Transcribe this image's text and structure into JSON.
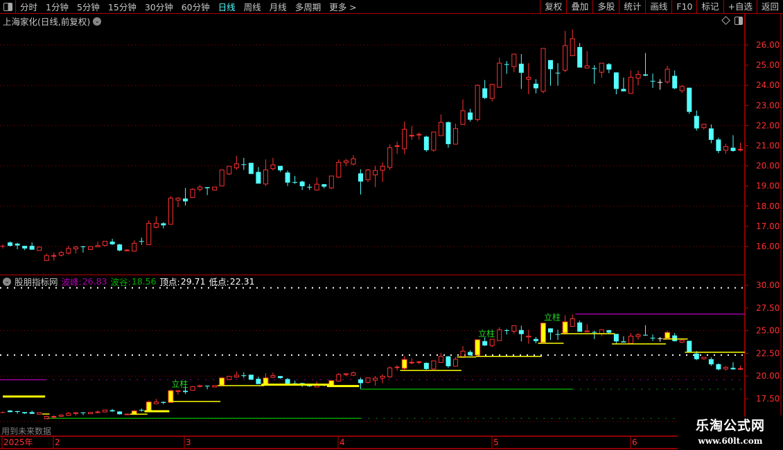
{
  "toolbar": {
    "periods": [
      "分时",
      "1分钟",
      "5分钟",
      "15分钟",
      "30分钟",
      "60分钟",
      "日线",
      "周线",
      "月线",
      "多周期",
      "更多 >"
    ],
    "active_period": "日线",
    "buttons": [
      "复权",
      "叠加",
      "多股",
      "统计",
      "画线",
      "F10",
      "标记",
      "+自选",
      "返回"
    ]
  },
  "chart_title": "上海家化(日线,前复权)",
  "indicator": {
    "name": "股朋指标网",
    "peak_label": "波峰:",
    "peak_value": "26.83",
    "trough_label": "波谷:",
    "trough_value": "18.56",
    "top_label": "顶点:",
    "top_value": "29.71",
    "low_label": "低点:",
    "low_value": "22.31",
    "signal_label": "立柱",
    "future_note": "用到未来数据"
  },
  "colors": {
    "up": "#ff3232",
    "down": "#54ffff",
    "highlight": "#ffff00",
    "axis": "#c00000",
    "peak": "#a000a0",
    "trough": "#00a000",
    "active_tab": "#54ffff"
  },
  "price_axis": {
    "labels": [
      "26.00",
      "25.00",
      "24.00",
      "23.00",
      "22.00",
      "21.00",
      "20.00",
      "19.00",
      "18.00",
      "17.00",
      "16.00"
    ]
  },
  "indicator_axis": {
    "labels": [
      "30.00",
      "27.50",
      "25.00",
      "22.50",
      "20.00",
      "17.50"
    ]
  },
  "date_axis": {
    "labels": [
      "2025年",
      "2",
      "3",
      "4",
      "5",
      "6"
    ]
  },
  "watermark": {
    "line1": "乐淘公式网",
    "line2": "www.60lt.com"
  },
  "chart_data": {
    "type": "candlestick",
    "ohlc_fields": [
      "open",
      "high",
      "low",
      "close"
    ],
    "candles": [
      [
        16.03,
        16.1,
        15.9,
        16.03
      ],
      [
        16.2,
        16.25,
        16.0,
        16.03
      ],
      [
        16.14,
        16.18,
        15.86,
        16.05
      ],
      [
        16.03,
        16.03,
        15.82,
        15.9
      ],
      [
        16.03,
        16.2,
        15.84,
        15.84
      ],
      [
        15.8,
        16.0,
        15.8,
        15.97
      ],
      [
        15.3,
        15.65,
        15.3,
        15.55
      ],
      [
        15.53,
        15.7,
        15.3,
        15.55
      ],
      [
        15.57,
        15.78,
        15.5,
        15.7
      ],
      [
        15.67,
        16.03,
        15.6,
        15.9
      ],
      [
        15.88,
        16.03,
        15.66,
        15.97
      ],
      [
        16.0,
        16.03,
        15.7,
        15.97
      ],
      [
        15.85,
        16.0,
        15.83,
        16.0
      ],
      [
        15.98,
        16.24,
        15.98,
        16.05
      ],
      [
        16.05,
        16.26,
        16.0,
        16.26
      ],
      [
        16.24,
        16.38,
        16.07,
        16.11
      ],
      [
        16.1,
        16.13,
        15.76,
        15.8
      ],
      [
        15.8,
        15.86,
        15.77,
        15.82
      ],
      [
        15.77,
        16.3,
        15.75,
        16.16
      ],
      [
        16.27,
        16.44,
        16.08,
        16.24
      ],
      [
        16.09,
        17.3,
        16.09,
        17.15
      ],
      [
        16.95,
        17.5,
        16.9,
        17.15
      ],
      [
        17.15,
        17.2,
        16.9,
        17.05
      ],
      [
        17.1,
        18.5,
        17.1,
        18.4
      ],
      [
        18.3,
        18.45,
        17.95,
        18.4
      ],
      [
        18.38,
        18.9,
        18.03,
        18.24
      ],
      [
        18.43,
        18.9,
        18.4,
        18.84
      ],
      [
        18.84,
        19.05,
        18.73,
        18.95
      ],
      [
        18.94,
        18.95,
        18.55,
        18.89
      ],
      [
        18.8,
        18.96,
        18.78,
        18.95
      ],
      [
        19.0,
        19.8,
        19.0,
        19.8
      ],
      [
        19.6,
        19.98,
        19.55,
        19.98
      ],
      [
        19.9,
        20.5,
        19.8,
        20.1
      ],
      [
        20.08,
        20.4,
        19.8,
        20.05
      ],
      [
        20.15,
        20.15,
        19.6,
        19.6
      ],
      [
        19.7,
        19.94,
        19.12,
        19.12
      ],
      [
        19.1,
        20.32,
        19.0,
        19.8
      ],
      [
        19.86,
        20.4,
        19.77,
        20.05
      ],
      [
        20.0,
        20.0,
        19.7,
        19.78
      ],
      [
        19.67,
        19.77,
        19.0,
        19.17
      ],
      [
        19.2,
        19.5,
        19.1,
        19.18
      ],
      [
        19.22,
        19.27,
        18.8,
        18.99
      ],
      [
        18.96,
        19.1,
        18.8,
        18.95
      ],
      [
        18.8,
        19.43,
        18.8,
        19.09
      ],
      [
        19.09,
        19.09,
        18.88,
        18.97
      ],
      [
        18.9,
        19.5,
        18.85,
        19.5
      ],
      [
        19.44,
        20.32,
        19.4,
        20.18
      ],
      [
        20.16,
        20.35,
        20.0,
        20.25
      ],
      [
        20.09,
        20.53,
        20.03,
        20.35
      ],
      [
        19.63,
        19.83,
        18.58,
        19.22
      ],
      [
        19.31,
        19.85,
        19.2,
        19.8
      ],
      [
        19.55,
        20.0,
        18.95,
        19.77
      ],
      [
        19.78,
        20.18,
        19.2,
        19.98
      ],
      [
        19.92,
        21.07,
        19.8,
        20.9
      ],
      [
        20.98,
        21.2,
        20.6,
        21.0
      ],
      [
        20.85,
        22.2,
        20.58,
        21.82
      ],
      [
        21.48,
        21.97,
        21.3,
        21.52
      ],
      [
        21.53,
        21.65,
        21.3,
        21.57
      ],
      [
        21.45,
        21.5,
        20.7,
        20.78
      ],
      [
        20.78,
        21.68,
        20.7,
        21.68
      ],
      [
        21.5,
        22.55,
        21.5,
        22.16
      ],
      [
        22.17,
        22.2,
        20.9,
        21.08
      ],
      [
        21.08,
        22.1,
        21.08,
        21.85
      ],
      [
        22.06,
        23.3,
        22.06,
        22.74
      ],
      [
        22.65,
        22.83,
        22.2,
        22.29
      ],
      [
        22.3,
        24.05,
        22.2,
        24.0
      ],
      [
        23.85,
        24.26,
        23.31,
        23.37
      ],
      [
        23.35,
        24.05,
        23.2,
        24.05
      ],
      [
        23.9,
        25.37,
        23.9,
        25.1
      ],
      [
        25.05,
        25.2,
        24.57,
        25.03
      ],
      [
        24.93,
        25.55,
        24.65,
        25.55
      ],
      [
        25.07,
        25.55,
        23.82,
        24.62
      ],
      [
        24.3,
        25.1,
        23.55,
        24.4
      ],
      [
        24.08,
        24.3,
        23.6,
        23.85
      ],
      [
        23.7,
        25.83,
        23.6,
        25.83
      ],
      [
        25.25,
        25.25,
        23.98,
        24.8
      ],
      [
        24.62,
        25.1,
        23.98,
        24.6
      ],
      [
        24.75,
        26.7,
        24.65,
        25.97
      ],
      [
        25.47,
        26.77,
        25.47,
        26.31
      ],
      [
        25.9,
        26.1,
        24.88,
        24.88
      ],
      [
        24.86,
        25.7,
        24.86,
        24.97
      ],
      [
        24.85,
        25.0,
        24.07,
        24.83
      ],
      [
        24.65,
        25.1,
        24.38,
        25.1
      ],
      [
        25.05,
        25.1,
        24.6,
        24.78
      ],
      [
        24.64,
        24.65,
        23.55,
        23.82
      ],
      [
        23.82,
        24.38,
        23.7,
        23.7
      ],
      [
        23.6,
        24.74,
        23.6,
        24.4
      ],
      [
        24.35,
        24.73,
        24.0,
        24.54
      ],
      [
        24.54,
        25.6,
        24.45,
        24.48
      ],
      [
        24.22,
        24.58,
        23.87,
        24.2
      ],
      [
        24.16,
        24.3,
        23.78,
        24.16
      ],
      [
        24.17,
        24.97,
        24.08,
        24.8
      ],
      [
        24.47,
        24.74,
        23.8,
        23.85
      ],
      [
        23.73,
        24.0,
        23.62,
        23.95
      ],
      [
        23.88,
        23.88,
        22.58,
        22.68
      ],
      [
        22.48,
        22.75,
        21.75,
        21.86
      ],
      [
        21.9,
        22.07,
        21.8,
        22.07
      ],
      [
        21.86,
        22.06,
        21.12,
        21.29
      ],
      [
        21.31,
        21.4,
        20.63,
        20.74
      ],
      [
        20.78,
        21.1,
        20.6,
        20.96
      ],
      [
        20.9,
        21.52,
        20.7,
        20.74
      ],
      [
        20.8,
        21.15,
        20.72,
        20.82
      ]
    ],
    "highlighted_candles": [
      18,
      20,
      23,
      30,
      36,
      45,
      55,
      65,
      74,
      77,
      91
    ],
    "signal_labels_at": [
      23,
      65,
      74
    ],
    "support_lines": [
      {
        "price": 17.75,
        "from": 0,
        "to": 5.8,
        "heavy": true
      },
      {
        "price": 15.82,
        "from": 5.4,
        "to": 6.4
      },
      {
        "price": 15.8,
        "from": 17.4,
        "to": 19.8
      },
      {
        "price": 16.13,
        "from": 19.4,
        "to": 22.8,
        "heavy": true
      },
      {
        "price": 17.2,
        "from": 22.8,
        "to": 29.8
      },
      {
        "price": 18.95,
        "from": 29.4,
        "to": 35.8
      },
      {
        "price": 19.05,
        "from": 35.4,
        "to": 44.7,
        "heavy": true
      },
      {
        "price": 18.9,
        "from": 44.4,
        "to": 48.8,
        "heavy": true
      },
      {
        "price": 20.62,
        "from": 54.4,
        "to": 62.8
      },
      {
        "price": 22.1,
        "from": 62.2,
        "to": 64.8
      },
      {
        "price": 22.17,
        "from": 64.8,
        "to": 73.8
      },
      {
        "price": 23.62,
        "from": 73.3,
        "to": 76.8
      },
      {
        "price": 24.66,
        "from": 76.4,
        "to": 83.8
      },
      {
        "price": 23.54,
        "from": 83.4,
        "to": 90.8
      },
      {
        "price": 24.08,
        "from": 90.4,
        "to": 93.8
      },
      {
        "price": 22.63,
        "from": 93.4,
        "to": 101.6
      }
    ],
    "reference_lines": [
      {
        "name": "peak",
        "price": 26.83,
        "from": 78.4,
        "color": "#a000a0"
      },
      {
        "name": "trough",
        "price": 18.56,
        "from": 49,
        "to": 78,
        "color": "#00a000"
      },
      {
        "name": "top",
        "price": 29.71,
        "color": "#ffffff"
      },
      {
        "name": "low",
        "price": 22.31,
        "color": "#ffffff"
      },
      {
        "name": "prior-peak",
        "price": 19.6,
        "to": 5.8,
        "color": "#a000a0"
      },
      {
        "name": "prior-trough",
        "price": 15.35,
        "from": 6,
        "to": 49,
        "color": "#00a000"
      }
    ],
    "price_ylim": [
      15.0,
      27.0
    ],
    "indicator_ylim": [
      15.0,
      30.5
    ]
  }
}
